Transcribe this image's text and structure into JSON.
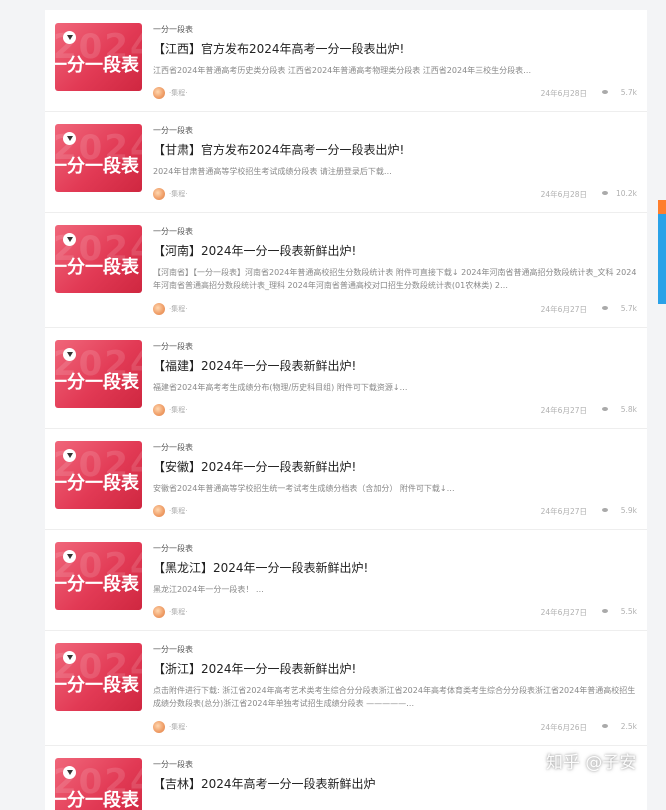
{
  "thumbnail": {
    "main_text": "一分一段表",
    "ghost_text": "2024"
  },
  "posts": [
    {
      "category": "一分一段表",
      "title": "【江西】官方发布2024年高考一分一段表出炉!",
      "excerpt": "江西省2024年普通高考历史类分段表 江西省2024年普通高考物理类分段表 江西省2024年三校生分段表…",
      "author": "·集程·",
      "date": "24年6月28日",
      "views": "5.7k"
    },
    {
      "category": "一分一段表",
      "title": "【甘肃】官方发布2024年高考一分一段表出炉!",
      "excerpt": "2024年甘肃普通高等学校招生考试成绩分段表 请注册登录后下载…",
      "author": "·集程·",
      "date": "24年6月28日",
      "views": "10.2k"
    },
    {
      "category": "一分一段表",
      "title": "【河南】2024年一分一段表新鲜出炉!",
      "excerpt": "【河南省】【一分一段表】河南省2024年普通高校招生分数段统计表 附件可直接下载↓ 2024年河南省普通高招分数段统计表_文科 2024年河南省普通高招分数段统计表_理科 2024年河南省普通高校对口招生分数段统计表(01农林类) 2…",
      "author": "·集程·",
      "date": "24年6月27日",
      "views": "5.7k"
    },
    {
      "category": "一分一段表",
      "title": "【福建】2024年一分一段表新鲜出炉!",
      "excerpt": "福建省2024年高考考生成绩分布(物理/历史科目组) 附件可下载资源↓…",
      "author": "·集程·",
      "date": "24年6月27日",
      "views": "5.8k"
    },
    {
      "category": "一分一段表",
      "title": "【安徽】2024年一分一段表新鲜出炉!",
      "excerpt": "安徽省2024年普通高等学校招生统一考试考生成绩分档表（含加分） 附件可下载↓…",
      "author": "·集程·",
      "date": "24年6月27日",
      "views": "5.9k"
    },
    {
      "category": "一分一段表",
      "title": "【黑龙江】2024年一分一段表新鲜出炉!",
      "excerpt": "黑龙江2024年一分一段表！ …",
      "author": "·集程·",
      "date": "24年6月27日",
      "views": "5.5k"
    },
    {
      "category": "一分一段表",
      "title": "【浙江】2024年一分一段表新鲜出炉!",
      "excerpt": "点击附件进行下载: 浙江省2024年高考艺术类考生综合分分段表浙江省2024年高考体育类考生综合分分段表浙江省2024年普通高校招生成绩分数段表(总分)浙江省2024年单独考试招生成绩分段表 —————…",
      "author": "·集程·",
      "date": "24年6月26日",
      "views": "2.5k"
    },
    {
      "category": "一分一段表",
      "title": "【吉林】2024年高考一分一段表新鲜出炉",
      "excerpt": "",
      "author": "",
      "date": "",
      "views": ""
    }
  ],
  "watermark": "知乎 @子安"
}
